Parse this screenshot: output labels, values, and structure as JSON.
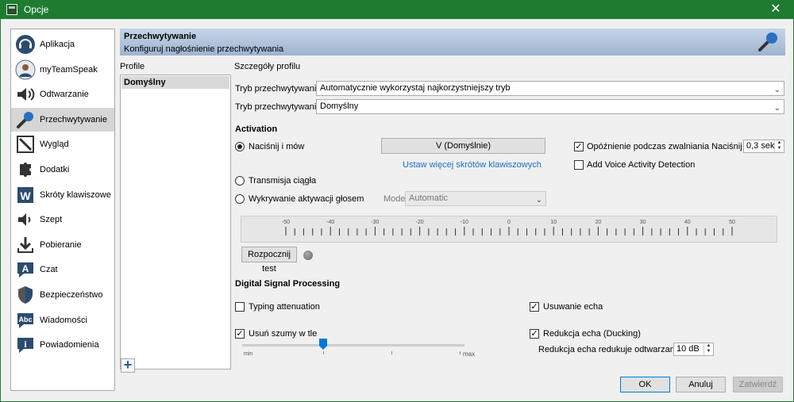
{
  "window": {
    "title": "Opcje",
    "close_glyph": "✕"
  },
  "sidebar": {
    "items": [
      {
        "label": "Aplikacja",
        "icon": "headset-icon"
      },
      {
        "label": "myTeamSpeak",
        "icon": "user-icon"
      },
      {
        "label": "Odtwarzanie",
        "icon": "speaker-icon"
      },
      {
        "label": "Przechwytywanie",
        "icon": "microphone-icon",
        "selected": true
      },
      {
        "label": "Wygląd",
        "icon": "pencil-icon"
      },
      {
        "label": "Dodatki",
        "icon": "puzzle-icon"
      },
      {
        "label": "Skróty klawiszowe",
        "icon": "keyboard-icon"
      },
      {
        "label": "Szept",
        "icon": "whisper-icon"
      },
      {
        "label": "Pobieranie",
        "icon": "download-icon"
      },
      {
        "label": "Czat",
        "icon": "chat-icon"
      },
      {
        "label": "Bezpieczeństwo",
        "icon": "shield-icon"
      },
      {
        "label": "Wiadomości",
        "icon": "messages-icon"
      },
      {
        "label": "Powiadomienia",
        "icon": "info-icon"
      }
    ]
  },
  "header": {
    "title": "Przechwytywanie",
    "subtitle": "Konfiguruj nagłośnienie przechwytywania"
  },
  "profiles": {
    "label": "Profile",
    "items": [
      "Domyślny"
    ],
    "add_glyph": "+"
  },
  "details": {
    "label": "Szczegóły profilu",
    "mode1": {
      "label": "Tryb przechwytywania:",
      "value": "Automatycznie wykorzystaj najkorzystniejszy tryb"
    },
    "mode2": {
      "label": "Tryb przechwytywania:",
      "value": "Domyślny"
    }
  },
  "activation": {
    "heading": "Activation",
    "ptt_label": "Naciśnij i mów",
    "ptt_key": "V (Domyślnie)",
    "more_hotkeys_link": "Ustaw więcej skrótów klawiszowych",
    "continuous_label": "Transmisja ciągła",
    "vad_label": "Wykrywanie aktywacji głosem",
    "mode_label": "Mode",
    "mode_value": "Automatic",
    "delay_label": "Opóźnienie podczas zwalniania Naciśnij i mów:",
    "delay_checked": true,
    "delay_value": "0,3 sek",
    "add_vad_label": "Add Voice Activity Detection",
    "add_vad_checked": false,
    "selected_mode": "ptt"
  },
  "meter": {
    "scale": [
      "-50",
      "-40",
      "-30",
      "-20",
      "-10",
      "0",
      "10",
      "20",
      "30",
      "40",
      "50"
    ],
    "test_button": "Rozpocznij test"
  },
  "dsp": {
    "heading": "Digital Signal Processing",
    "typing_label": "Typing attenuation",
    "typing_checked": false,
    "noise_label": "Usuń szumy w tle",
    "noise_checked": true,
    "noise_level": 0.35,
    "min_label": "min",
    "max_label": "max",
    "echo_label": "Usuwanie echa",
    "echo_checked": true,
    "ducking_label": "Redukcja echa (Ducking)",
    "ducking_checked": true,
    "ducking_value_label": "Redukcja echa redukuje odtwarzanie o:",
    "ducking_value": "10 dB"
  },
  "buttons": {
    "ok": "OK",
    "cancel": "Anuluj",
    "apply": "Zatwierdź"
  },
  "colors": {
    "titlebar": "#1e7c30",
    "link": "#1c6fc4",
    "accent": "#0078d7"
  }
}
